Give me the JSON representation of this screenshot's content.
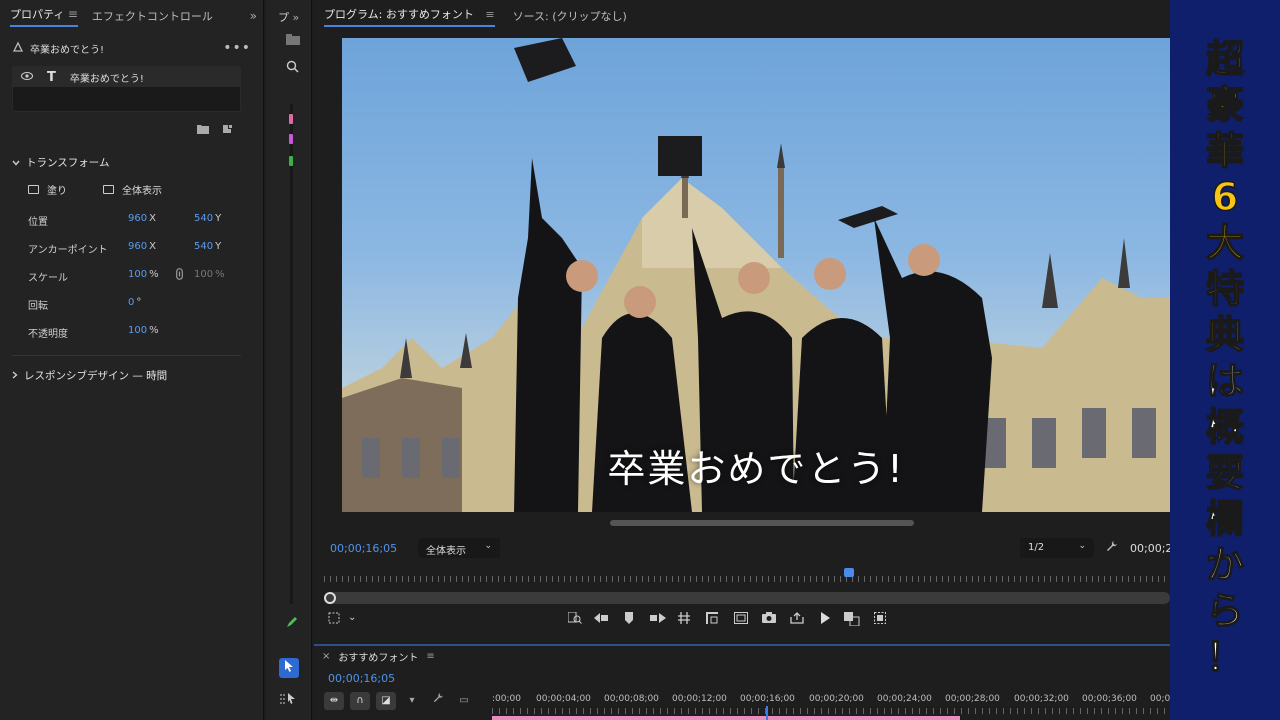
{
  "properties_panel": {
    "tab_active": "プロパティ",
    "tab_menu": "≡",
    "tab_other": "エフェクトコントロール",
    "more": "»",
    "clip_name": "卒業おめでとう!",
    "layer_name": "卒業おめでとう!",
    "transform_section": "トランスフォーム",
    "fill_label": "塗り",
    "show_all_label": "全体表示",
    "rows": [
      {
        "label": "位置",
        "v1": "960",
        "u1": "X",
        "v2": "540",
        "u2": "Y"
      },
      {
        "label": "アンカーポイント",
        "v1": "960",
        "u1": "X",
        "v2": "540",
        "u2": "Y"
      },
      {
        "label": "スケール",
        "v1": "100",
        "u1": "%",
        "v2": "100",
        "u2": "%"
      },
      {
        "label": "回転",
        "v1": "0",
        "u1": "°",
        "v2": "",
        "u2": ""
      },
      {
        "label": "不透明度",
        "v1": "100",
        "u1": "%",
        "v2": "",
        "u2": ""
      }
    ],
    "responsive_section": "レスポンシブデザイン — 時間"
  },
  "mid_column": {
    "tab_label": "プ",
    "more": "»"
  },
  "program_monitor": {
    "tab_active": "プログラム: おすすめフォント",
    "tab_menu": "≡",
    "tab_source": "ソース: (クリップなし)",
    "caption": "卒業おめでとう!",
    "timecode_left": "00;00;16;05",
    "fit_select": "全体表示",
    "resolution_select": "1/2",
    "timecode_right": "00;00;2",
    "colors": {
      "timecode": "#4f94ec",
      "playhead": "#4a8be8"
    }
  },
  "timeline": {
    "close": "×",
    "sequence_name": "おすすめフォント",
    "menu": "≡",
    "timecode": "00;00;16;05",
    "ruler_labels": [
      ":00;00",
      "00;00;04;00",
      "00;00;08;00",
      "00;00;12;00",
      "00;00;16;00",
      "00;00;20;00",
      "00;00;24;00",
      "00;00;28;00",
      "00;00;32;00",
      "00;00;36;00",
      "00;0"
    ]
  },
  "banner": {
    "yellow_chars": [
      "超",
      "豪",
      "華",
      "6",
      "大",
      "特",
      "典"
    ],
    "white_chars": [
      "は",
      "概",
      "要",
      "欄",
      "か",
      "ら",
      "！"
    ],
    "colors": {
      "background": "#0f1f6b",
      "yellow": "#f7c515"
    }
  }
}
